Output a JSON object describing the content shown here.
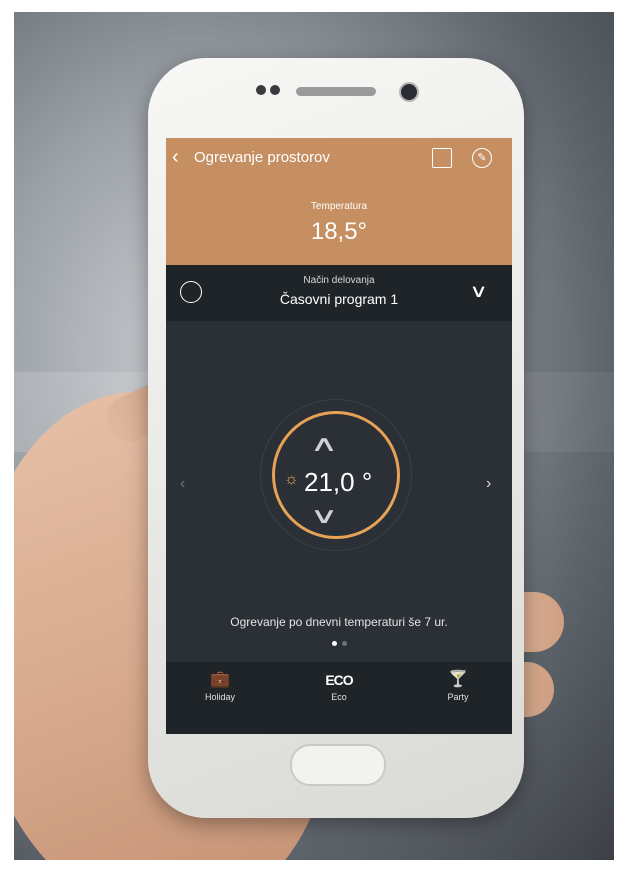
{
  "app": {
    "title": "Ogrevanje prostorov",
    "icons": {
      "back": "chevron-left-icon",
      "calendar": "calendar-clock-icon",
      "edit": "pencil-icon"
    }
  },
  "temperature": {
    "label": "Temperatura",
    "value": "18,5°"
  },
  "mode": {
    "label": "Način delovanja",
    "value": "Časovni program 1",
    "icon": "history-clock-icon"
  },
  "dial": {
    "setpoint": "21,0 °",
    "icon": "sun-icon"
  },
  "status_text": "Ogrevanje po dnevni temperaturi še 7 ur.",
  "pagination": {
    "current": 1,
    "total": 2
  },
  "bottom_tabs": [
    {
      "label": "Holiday",
      "icon": "suitcase-icon"
    },
    {
      "label": "Eco",
      "icon_text": "ECO",
      "icon": "eco-icon"
    },
    {
      "label": "Party",
      "icon": "cocktail-icon"
    }
  ],
  "colors": {
    "accent": "#c68f62",
    "ring": "#e6a255",
    "background": "#2a3035",
    "bars": "#1f2428"
  }
}
